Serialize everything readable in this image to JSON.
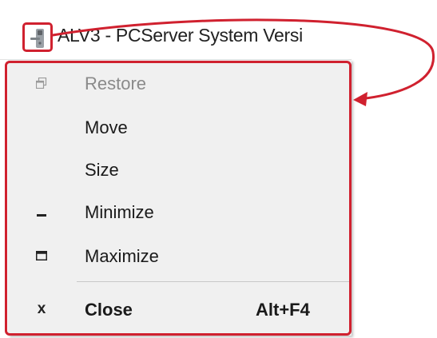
{
  "window": {
    "title": "ALV3 - PCServer System Versi",
    "icon": "door-lock-icon"
  },
  "system_menu": {
    "items": [
      {
        "label": "Restore",
        "icon": "restore-icon",
        "enabled": false
      },
      {
        "label": "Move",
        "icon": "",
        "enabled": true
      },
      {
        "label": "Size",
        "icon": "",
        "enabled": true
      },
      {
        "label": "Minimize",
        "icon": "minimize-icon",
        "enabled": true
      },
      {
        "label": "Maximize",
        "icon": "maximize-icon",
        "enabled": true
      },
      {
        "label": "Close",
        "icon": "close-icon",
        "shortcut": "Alt+F4",
        "enabled": true,
        "bold": true
      }
    ]
  },
  "colors": {
    "highlight": "#d0212f",
    "menu_background": "#f0f0f0",
    "disabled_text": "#8a8a8a"
  }
}
